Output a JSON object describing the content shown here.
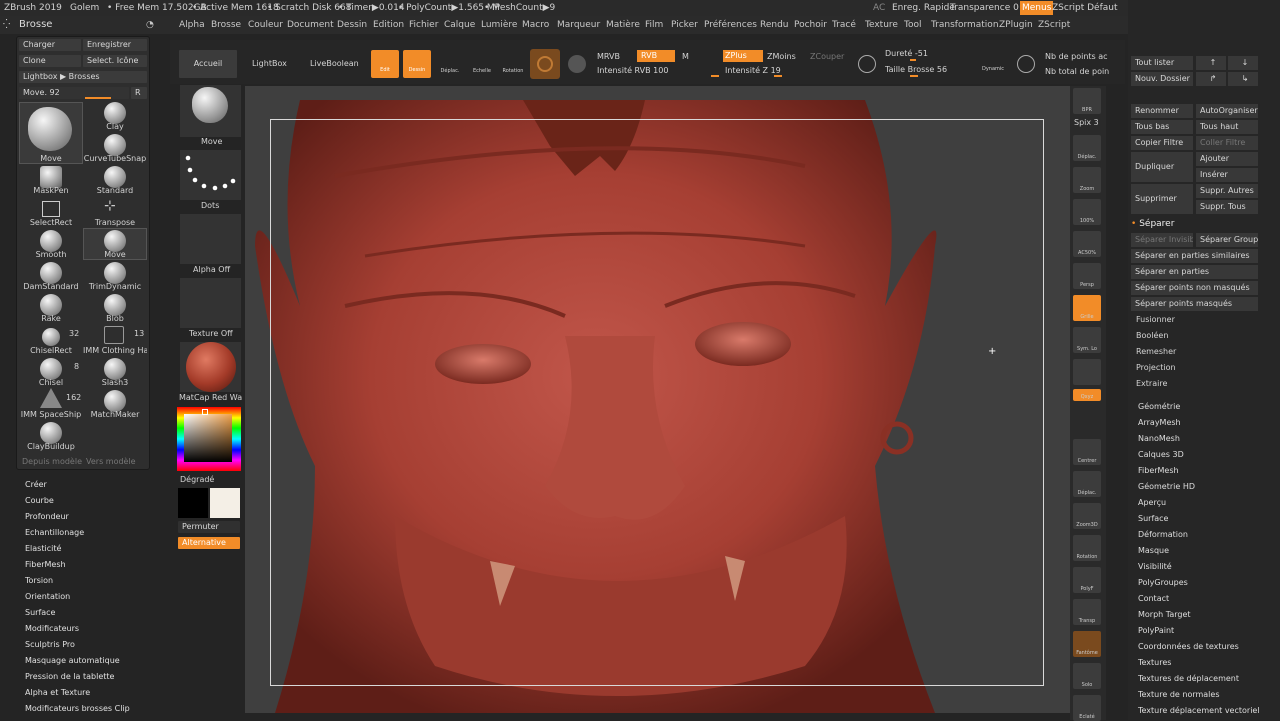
{
  "topbar": {
    "app": "ZBrush 2019",
    "project": "Golem",
    "freemem": "• Free Mem 17.502GB",
    "activemem": "• Active Mem 1618",
    "scratch": "• Scratch Disk 668",
    "timer": "• Timer▶0.014",
    "polycount": "• PolyCount▶1.565 MP",
    "meshcount": "• MeshCount▶9",
    "ac": "AC",
    "quicksave": "Enreg. Rapide",
    "transparence": "Transparence 0",
    "menus": "Menus",
    "zscript": "ZScript Défaut"
  },
  "menubar": [
    "Alpha",
    "Brosse",
    "Couleur",
    "Document",
    "Dessin",
    "Edition",
    "Fichier",
    "Calque",
    "Lumière",
    "Macro",
    "Marqueur",
    "Matière",
    "Film",
    "Picker",
    "Préférences",
    "Rendu",
    "Pochoir",
    "Tracé",
    "Texture",
    "Tool",
    "Transformation",
    "ZPlugin",
    "ZScript"
  ],
  "leftpanel": {
    "title": "Brosse",
    "load": "Charger",
    "save": "Enregistrer",
    "clone": "Clone",
    "select_icon": "Select. Icône",
    "lightbox": "Lightbox ▶ Brosses",
    "move_label": "Move. 92",
    "r": "R",
    "from_model": "Depuis modèle",
    "to_model": "Vers modèle",
    "brushes": [
      {
        "name": "Move"
      },
      {
        "name": "Clay"
      },
      {
        "name": "CurveTubeSnap"
      },
      {
        "name": "MaskPen"
      },
      {
        "name": "Standard"
      },
      {
        "name": "SelectRect"
      },
      {
        "name": "Transpose"
      },
      {
        "name": "Smooth"
      },
      {
        "name": "Move"
      },
      {
        "name": "DamStandard"
      },
      {
        "name": "TrimDynamic"
      },
      {
        "name": "Rake"
      },
      {
        "name": "Blob"
      },
      {
        "name": "ChiselRect"
      },
      {
        "name": "IMM Clothing Ha"
      },
      {
        "name": "Chisel"
      },
      {
        "name": "Slash3"
      },
      {
        "name": "IMM SpaceShip"
      },
      {
        "name": "MatchMaker"
      },
      {
        "name": "ClayBuildup"
      }
    ],
    "counts": {
      "chiselrect": "32",
      "imm": "13",
      "chisel": "8",
      "spaceship": "162"
    }
  },
  "leftmenu": [
    "Créer",
    "Courbe",
    "Profondeur",
    "Echantillonage",
    "Elasticité",
    "FiberMesh",
    "Torsion",
    "Orientation",
    "Surface",
    "Modificateurs",
    "Sculptris Pro",
    "Masquage automatique",
    "Pression de la tablette",
    "Alpha et Texture",
    "Modificateurs brosses Clip"
  ],
  "shelf": {
    "accueil": "Accueil",
    "lightbox": "LightBox",
    "liveboolean": "LiveBoolean",
    "edit": "Edit",
    "draw": "Dessin",
    "move": "Déplac.",
    "scale": "Echelle",
    "rotate": "Rotation",
    "mrvb": "MRVB",
    "rvb": "RVB",
    "m": "M",
    "intensite_rvb": "Intensité RVB 100",
    "zplus": "ZPlus",
    "zmoins": "ZMoins",
    "zcouper": "ZCouper",
    "intensite_z": "Intensité Z 19",
    "durete": "Dureté -51",
    "taille": "Taille Brosse 56",
    "dynamic": "Dynamic",
    "pts_active": "Nb de points ac",
    "pts_total": "Nb total de poin"
  },
  "midcolumn": {
    "move": "Move",
    "dots": "Dots",
    "alpha_off": "Alpha Off",
    "texture_off": "Texture Off",
    "matcap": "MatCap Red Wa",
    "gradient": "Dégradé",
    "switch": "Permuter",
    "alternative": "Alternative"
  },
  "righttools": [
    {
      "name": "bpr",
      "label": "BPR"
    },
    {
      "name": "spix",
      "label": "Spix 3"
    },
    {
      "name": "move",
      "label": "Déplac."
    },
    {
      "name": "zoom",
      "label": "Zoom"
    },
    {
      "name": "zoom100",
      "label": "100%"
    },
    {
      "name": "actual",
      "label": "AC50%"
    },
    {
      "name": "persp",
      "label": "Persp"
    },
    {
      "name": "floor",
      "label": "Grille"
    },
    {
      "name": "sym",
      "label": "Sym. Lo"
    },
    {
      "name": "lock",
      "label": ""
    },
    {
      "name": "xyz",
      "label": "Qxyz"
    },
    {
      "name": "center",
      "label": "Centrer"
    },
    {
      "name": "move2",
      "label": "Déplac."
    },
    {
      "name": "zoom3d",
      "label": "Zoom3D"
    },
    {
      "name": "rotate",
      "label": "Rotation"
    },
    {
      "name": "polyf",
      "label": "PolyF"
    },
    {
      "name": "transp",
      "label": "Transp"
    },
    {
      "name": "ghost",
      "label": "Fantôme"
    },
    {
      "name": "solo",
      "label": "Solo"
    },
    {
      "name": "xpose",
      "label": "Eclaté"
    }
  ],
  "rightpanel": {
    "list_all": "Tout lister",
    "new_folder": "Nouv. Dossier",
    "rename": "Renommer",
    "autoorganize": "AutoOrganiser",
    "all_low": "Tous bas",
    "all_high": "Tous haut",
    "copy_filter": "Copier Filtre",
    "paste_filter": "Coller Filtre",
    "duplicate": "Dupliquer",
    "add": "Ajouter",
    "insert": "Insérer",
    "delete": "Supprimer",
    "del_other": "Suppr. Autres",
    "del_all": "Suppr. Tous",
    "split": "Séparer",
    "split_hidden": "Séparer Invisibl",
    "split_groups": "Séparer Groupe",
    "split_similar": "Séparer en parties similaires",
    "split_parts": "Séparer en parties",
    "split_unmasked": "Séparer points non masqués",
    "split_masked": "Séparer points masqués",
    "merge": "Fusionner",
    "boolean": "Booléen",
    "remesh": "Remesher",
    "project": "Projection",
    "extract": "Extraire",
    "menus": [
      "Géométrie",
      "ArrayMesh",
      "NanoMesh",
      "Calques 3D",
      "FiberMesh",
      "Géometrie HD",
      "Aperçu",
      "Surface",
      "Déformation",
      "Masque",
      "Visibilité",
      "PolyGroupes",
      "Contact",
      "Morph Target",
      "PolyPaint",
      "Coordonnées de textures",
      "Textures",
      "Textures de déplacement",
      "Texture de normales",
      "Texture déplacement vectoriel"
    ]
  },
  "colors": {
    "accent": "#f28c28",
    "skin": "#b0483a"
  }
}
